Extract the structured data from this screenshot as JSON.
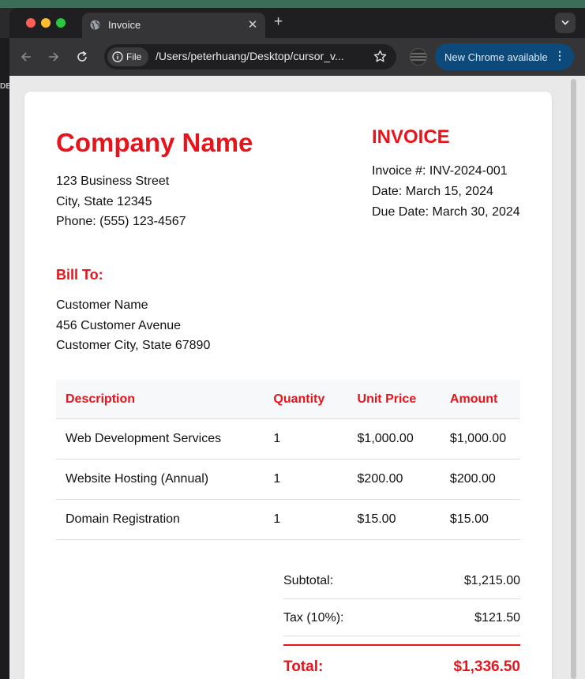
{
  "browser": {
    "tab_title": "Invoice",
    "new_tab_label": "+",
    "address_chip": "File",
    "url": "/Users/peterhuang/Desktop/cursor_v...",
    "update_label": "New Chrome available",
    "side_label": "DE"
  },
  "company": {
    "name": "Company Name",
    "address_lines": [
      "123 Business Street",
      "City, State 12345",
      "Phone: (555) 123-4567"
    ]
  },
  "invoice": {
    "title": "INVOICE",
    "number": "Invoice #: INV-2024-001",
    "date": "Date: March 15, 2024",
    "due_date": "Due Date: March 30, 2024"
  },
  "bill_to": {
    "title": "Bill To:",
    "lines": [
      "Customer Name",
      "456 Customer Avenue",
      "Customer City, State 67890"
    ]
  },
  "table": {
    "headers": [
      "Description",
      "Quantity",
      "Unit Price",
      "Amount"
    ],
    "rows": [
      [
        "Web Development Services",
        "1",
        "$1,000.00",
        "$1,000.00"
      ],
      [
        "Website Hosting (Annual)",
        "1",
        "$200.00",
        "$200.00"
      ],
      [
        "Domain Registration",
        "1",
        "$15.00",
        "$15.00"
      ]
    ]
  },
  "totals": {
    "subtotal_label": "Subtotal:",
    "subtotal": "$1,215.00",
    "tax_label": "Tax (10%):",
    "tax": "$121.50",
    "total_label": "Total:",
    "total": "$1,336.50"
  },
  "colors": {
    "accent": "#e8141c",
    "chrome_bg": "#353537",
    "update_btn": "#0b4a7a"
  },
  "icons": [
    "globe-icon",
    "close-icon",
    "back-icon",
    "forward-icon",
    "reload-icon",
    "info-icon",
    "star-icon",
    "kebab-menu-icon",
    "chevron-down-icon"
  ]
}
